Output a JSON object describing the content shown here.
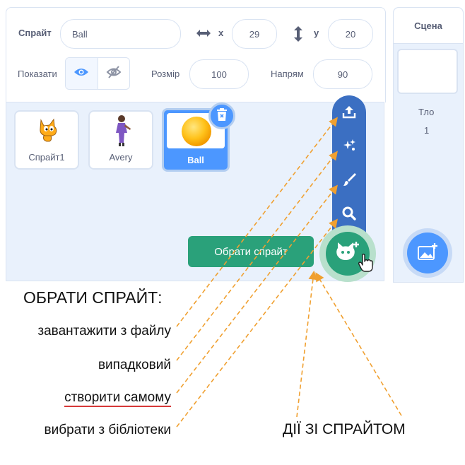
{
  "sprite_info": {
    "sprite_label": "Спрайт",
    "sprite_name": "Ball",
    "x_label": "x",
    "x_value": "29",
    "y_label": "y",
    "y_value": "20",
    "show_label": "Показати",
    "size_label": "Розмір",
    "size_value": "100",
    "direction_label": "Напрям",
    "direction_value": "90"
  },
  "sprites": [
    {
      "name": "Спрайт1",
      "icon": "cat-icon",
      "selected": false
    },
    {
      "name": "Avery",
      "icon": "person-icon",
      "selected": false
    },
    {
      "name": "Ball",
      "icon": "ball-icon",
      "selected": true
    }
  ],
  "stage": {
    "title": "Сцена",
    "backdrops_label": "Тло",
    "backdrops_count": "1"
  },
  "choose_sprite_tooltip": "Обрати спрайт",
  "sprite_menu_icons": [
    "upload-icon",
    "surprise-icon",
    "paint-icon",
    "search-icon"
  ],
  "annotations": {
    "title": "ОБРАТИ СПРАЙТ:",
    "items": [
      "завантажити з файлу",
      "випадковий",
      "створити самому",
      "вибрати з бібліотеки"
    ],
    "actions_label": "ДІЇ ЗІ СПРАЙТОМ"
  },
  "colors": {
    "accent_blue": "#4c97ff",
    "menu_blue": "#3b6fc2",
    "green": "#2aa17a",
    "arrow_orange": "#f0a030",
    "underline_red": "#d63838"
  }
}
